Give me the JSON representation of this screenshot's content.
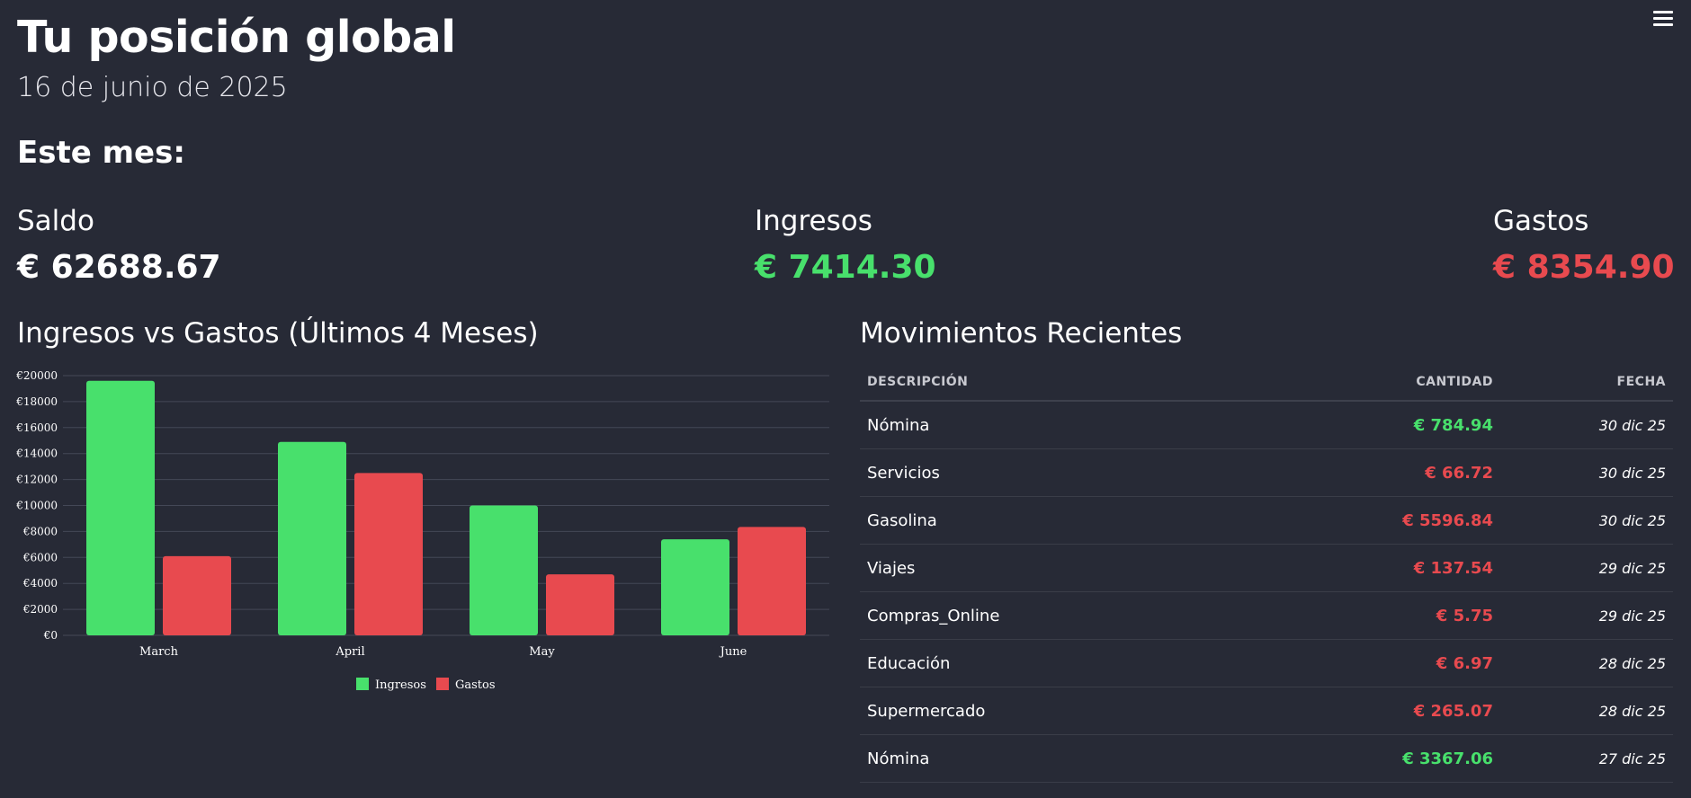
{
  "header": {
    "title": "Tu posición global",
    "date": "16 de junio de 2025",
    "menu_icon": "hamburger-menu-icon"
  },
  "summary": {
    "heading": "Este mes:",
    "saldo": {
      "label": "Saldo",
      "value": "€ 62688.67"
    },
    "ingresos": {
      "label": "Ingresos",
      "value": "€ 7414.30",
      "color": "#48e06c"
    },
    "gastos": {
      "label": "Gastos",
      "value": "€ 8354.90",
      "color": "#e84a4f"
    }
  },
  "chart_section": {
    "title": "Ingresos vs Gastos (Últimos 4 Meses)"
  },
  "chart_data": {
    "type": "bar",
    "categories": [
      "March",
      "April",
      "May",
      "June"
    ],
    "series": [
      {
        "name": "Ingresos",
        "color": "#48e06c",
        "values": [
          19600,
          14900,
          10000,
          7400
        ]
      },
      {
        "name": "Gastos",
        "color": "#e84a4f",
        "values": [
          6100,
          12500,
          4700,
          8350
        ]
      }
    ],
    "ylim": [
      0,
      20000
    ],
    "yticks": [
      "€20000",
      "€18000",
      "€16000",
      "€14000",
      "€12000",
      "€10000",
      "€8000",
      "€6000",
      "€4000",
      "€2000",
      "€0"
    ],
    "ytick_values": [
      20000,
      18000,
      16000,
      14000,
      12000,
      10000,
      8000,
      6000,
      4000,
      2000,
      0
    ],
    "grid": true,
    "legend": "bottom"
  },
  "table_section": {
    "title": "Movimientos Recientes",
    "columns": [
      "DESCRIPCIÓN",
      "CANTIDAD",
      "FECHA"
    ],
    "rows": [
      {
        "desc": "Nómina",
        "amount": "€ 784.94",
        "type": "income",
        "date": "30 dic 25"
      },
      {
        "desc": "Servicios",
        "amount": "€ 66.72",
        "type": "expense",
        "date": "30 dic 25"
      },
      {
        "desc": "Gasolina",
        "amount": "€ 5596.84",
        "type": "expense",
        "date": "30 dic 25"
      },
      {
        "desc": "Viajes",
        "amount": "€ 137.54",
        "type": "expense",
        "date": "29 dic 25"
      },
      {
        "desc": "Compras_Online",
        "amount": "€ 5.75",
        "type": "expense",
        "date": "29 dic 25"
      },
      {
        "desc": "Educación",
        "amount": "€ 6.97",
        "type": "expense",
        "date": "28 dic 25"
      },
      {
        "desc": "Supermercado",
        "amount": "€ 265.07",
        "type": "expense",
        "date": "28 dic 25"
      },
      {
        "desc": "Nómina",
        "amount": "€ 3367.06",
        "type": "income",
        "date": "27 dic 25"
      }
    ]
  }
}
